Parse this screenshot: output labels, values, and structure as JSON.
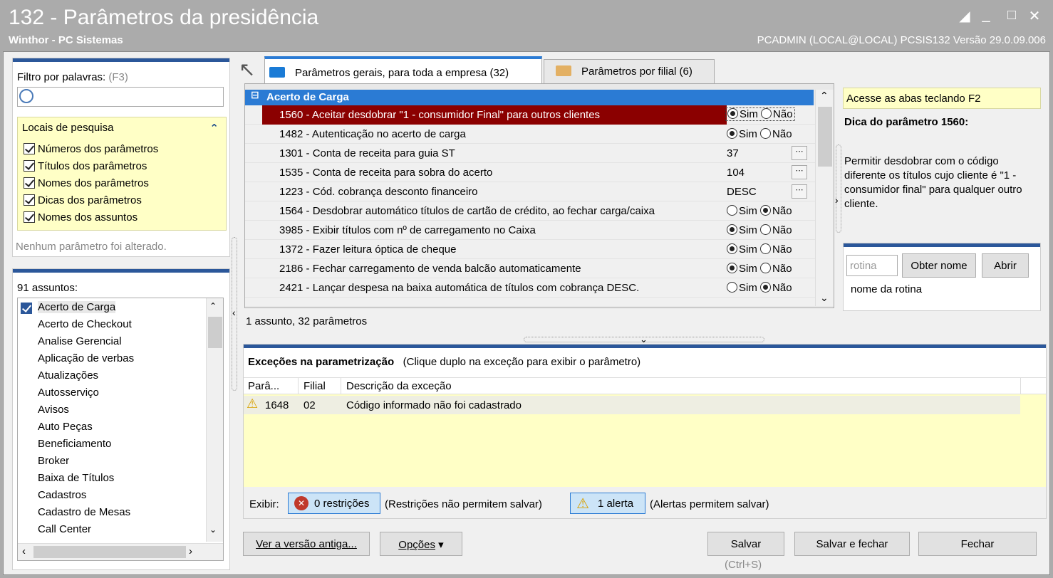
{
  "window": {
    "title": "132 - Parâmetros da presidência",
    "subtitle": "Winthor - PC Sistemas",
    "user_info": "PCADMIN (LOCAL@LOCAL)   PCSIS132  Versão  29.0.09.006",
    "controls": [
      "restore-icon",
      "minimize-icon",
      "maximize-icon",
      "close-icon"
    ]
  },
  "filter": {
    "label": "Filtro por palavras:",
    "shortcut": "(F3)",
    "search_value": "",
    "locais_title": "Locais de pesquisa",
    "options": [
      {
        "label": "Números dos parâmetros",
        "checked": true
      },
      {
        "label": "Títulos dos parâmetros",
        "checked": true
      },
      {
        "label": "Nomes dos parâmetros",
        "checked": true
      },
      {
        "label": "Dicas dos parâmetros",
        "checked": true
      },
      {
        "label": "Nomes dos assuntos",
        "checked": true
      }
    ],
    "status": "Nenhum parâmetro foi alterado."
  },
  "subjects": {
    "count_label": "91 assuntos:",
    "items": [
      "Acerto de Carga",
      "Acerto de Checkout",
      "Analise Gerencial",
      "Aplicação de verbas",
      "Atualizações",
      "Autosserviço",
      "Avisos",
      "Auto Peças",
      "Beneficiamento",
      "Broker",
      "Baixa de Títulos",
      "Cadastros",
      "Cadastro de Mesas",
      "Call Center"
    ]
  },
  "tabs": [
    {
      "label": "Parâmetros gerais, para toda a empresa  (32)",
      "active": true
    },
    {
      "label": "Parâmetros por filial  (6)",
      "active": false
    }
  ],
  "grid": {
    "group": "Acerto de Carga",
    "yes": "Sim",
    "no": "Não",
    "rows": [
      {
        "name": "1560 - Aceitar desdobrar \"1 - consumidor Final\" para outros clientes",
        "type": "bool",
        "value": "Sim",
        "selected": true
      },
      {
        "name": "1482 - Autenticação no acerto de carga",
        "type": "bool",
        "value": "Sim"
      },
      {
        "name": "1301 - Conta de receita para guia ST",
        "type": "text",
        "value": "37"
      },
      {
        "name": "1535 - Conta de receita para sobra do acerto",
        "type": "text",
        "value": "104"
      },
      {
        "name": "1223 - Cód. cobrança desconto financeiro",
        "type": "text",
        "value": "DESC"
      },
      {
        "name": "1564 - Desdobrar automático títulos de cartão de crédito, ao fechar carga/caixa",
        "type": "bool",
        "value": "Não"
      },
      {
        "name": "3985 - Exibir títulos com nº de carregamento no Caixa",
        "type": "bool",
        "value": "Sim"
      },
      {
        "name": "1372 - Fazer leitura óptica de cheque",
        "type": "bool",
        "value": "Sim"
      },
      {
        "name": "2186 - Fechar carregamento de venda balcão automaticamente",
        "type": "bool",
        "value": "Sim"
      },
      {
        "name": "2421 - Lançar despesa na baixa automática de títulos com cobrança DESC.",
        "type": "bool",
        "value": "Não"
      }
    ],
    "footer": "1 assunto, 32 parâmetros"
  },
  "hint": {
    "banner": "Acesse as abas teclando F2",
    "title": "Dica do parâmetro 1560:",
    "text": "Permitir desdobrar com o código diferente os títulos cujo cliente é \"1 - consumidor final\" para qualquer outro cliente.",
    "routine_placeholder": "rotina",
    "get_name": "Obter nome",
    "open": "Abrir",
    "routine_name": "nome da rotina"
  },
  "exceptions": {
    "title": "Exceções na parametrização",
    "note": "(Clique duplo na exceção para exibir o parâmetro)",
    "columns": [
      "Parâ...",
      "Filial",
      "Descrição da exceção"
    ],
    "rows": [
      {
        "param": "1648",
        "filial": "02",
        "desc": "Código informado não foi cadastrado"
      }
    ],
    "show_label": "Exibir:",
    "restrictions_btn": "0 restrições",
    "restrictions_note": "(Restrições não permitem salvar)",
    "alerts_btn": "1 alerta",
    "alerts_note": "(Alertas permitem salvar)"
  },
  "buttons": {
    "old_version": "Ver a versão antiga...",
    "options": "Opções",
    "save": "Salvar",
    "save_shortcut": "(Ctrl+S)",
    "save_close": "Salvar e fechar",
    "close": "Fechar"
  },
  "colors": {
    "accent": "#2b579a",
    "selected_row": "#8b0000",
    "hint_yellow": "#ffffc6"
  }
}
